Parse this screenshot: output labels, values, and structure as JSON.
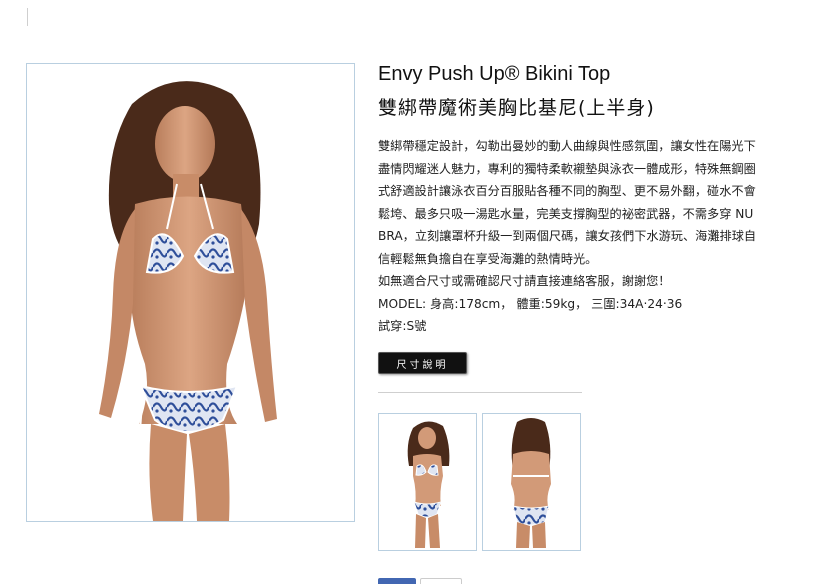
{
  "product": {
    "title_en": "Envy Push Up® Bikini Top",
    "title_zh": "雙綁帶魔術美胸比基尼(上半身)",
    "description_lines": [
      "雙綁帶穩定設計，勾勒出曼妙的動人曲線與性感氛圍，讓女性在陽光下",
      "盡情閃耀迷人魅力，專利的獨特柔軟襯墊與泳衣一體成形，特殊無鋼圈",
      "式舒適設計讓泳衣百分百服貼各種不同的胸型、更不易外翻，碰水不會",
      "鬆垮、最多只吸一湯匙水量，完美支撐胸型的祕密武器，不需多穿 NU",
      "BRA，立刻讓罩杯升級一到兩個尺碼，讓女孩們下水游玩、海灘排球自",
      "信輕鬆無負擔自在享受海灘的熱情時光。",
      "如無適合尺寸或需確認尺寸請直接連絡客服，謝謝您！",
      "MODEL: 身高:178cm，  體重:59kg，  三圍:34A‧24‧36",
      "試穿:S號"
    ],
    "size_button_label": "尺寸說明"
  },
  "images": {
    "main": "model-front-photo",
    "thumbnails": [
      "model-front-thumbnail",
      "model-back-thumbnail"
    ]
  },
  "colors": {
    "frame_border": "#b9cfe0",
    "button_bg": "#111111",
    "facebook_blue": "#4267b2",
    "bikini_blue": "#2f4f9a"
  }
}
